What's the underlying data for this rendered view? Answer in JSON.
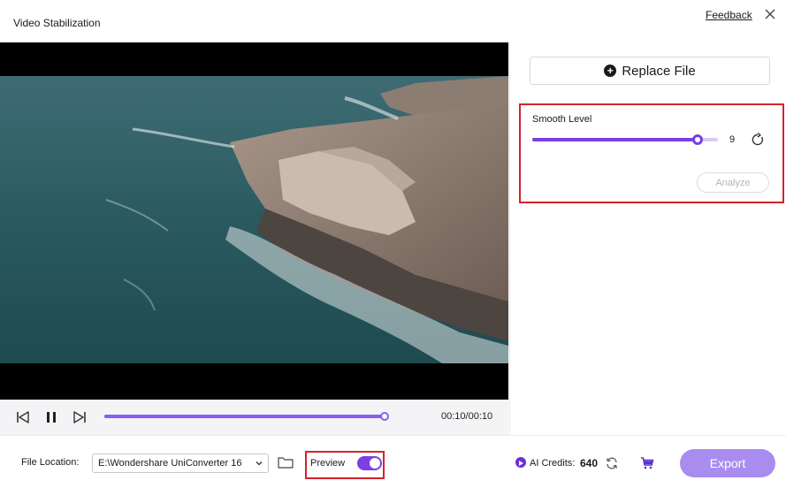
{
  "window": {
    "title": "Video Stabilization",
    "feedback_label": "Feedback"
  },
  "player": {
    "time": "00:10/00:10",
    "progress_fraction": 1.0
  },
  "right_panel": {
    "replace_label": "Replace File",
    "smooth_label": "Smooth Level",
    "smooth_value": "9",
    "smooth_fraction": 0.89,
    "analyze_label": "Analyze"
  },
  "bottom": {
    "file_location_label": "File Location:",
    "file_location_value": "E:\\Wondershare UniConverter 16",
    "preview_label": "Preview",
    "preview_on": true,
    "ai_credits_label": "AI Credits:",
    "ai_credits_value": "640",
    "export_label": "Export"
  },
  "colors": {
    "accent": "#7b3fe4",
    "export": "#a98cf0",
    "highlight": "#d2232a"
  }
}
